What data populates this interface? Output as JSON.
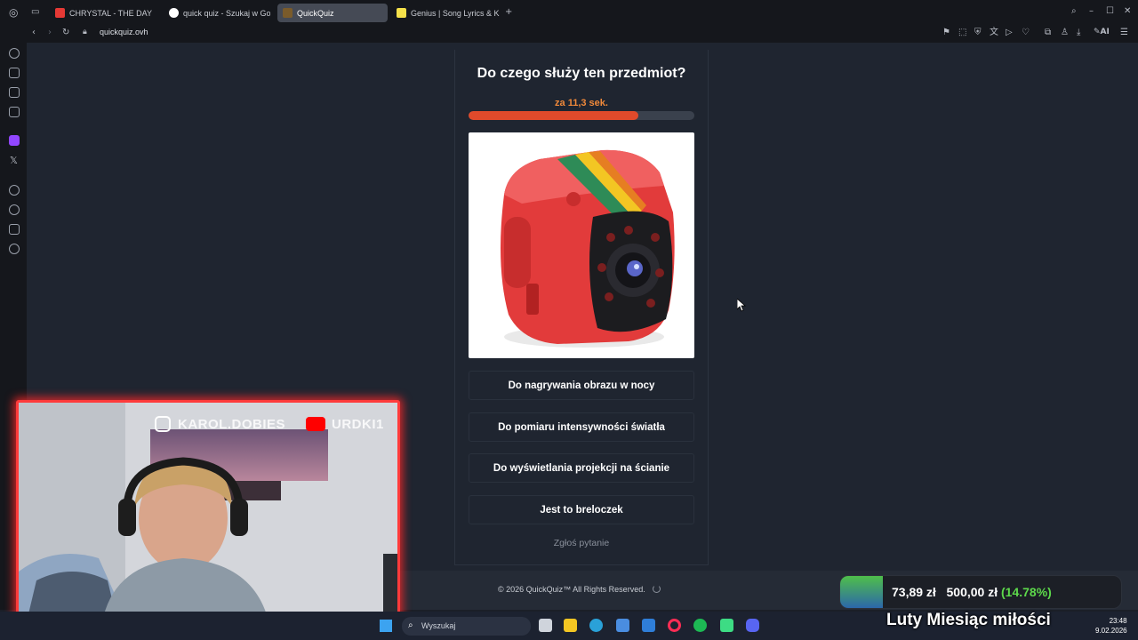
{
  "tabs": [
    {
      "label": "CHRYSTAL - THE DAY",
      "color": "#e53935"
    },
    {
      "label": "quick quiz - Szukaj w Goo",
      "color": "#4285f4"
    },
    {
      "label": "QuickQuiz",
      "color": "#7a5b2b"
    },
    {
      "label": "Genius | Song Lyrics & Kno",
      "color": "#f5e14a"
    }
  ],
  "address": {
    "url": "quickquiz.ovh"
  },
  "quiz": {
    "question": "Do czego służy ten przedmiot?",
    "timer": "za 11,3 sek.",
    "progress": 0.75,
    "image_alt": "red mini camera cube",
    "answers": [
      "Do nagrywania obrazu w nocy",
      "Do pomiaru intensywności światła",
      "Do wyświetlania projekcji na ścianie",
      "Jest to breloczek"
    ],
    "report_label": "Zgłoś pytanie"
  },
  "footer": {
    "copyright": "© 2026  QuickQuiz™ All Rights Reserved."
  },
  "overlay": {
    "instagram_handle": "KAROL.DOBIES",
    "youtube_handle": "URDKI1",
    "stats": {
      "amount": "73,89 zł",
      "goal": "500,00 zł",
      "percent": "(14.78%)"
    },
    "banner": "Luty Miesiąc miłości"
  },
  "taskbar": {
    "search_placeholder": "Wyszukaj",
    "time": "23:48",
    "date": "9.02.2026"
  }
}
